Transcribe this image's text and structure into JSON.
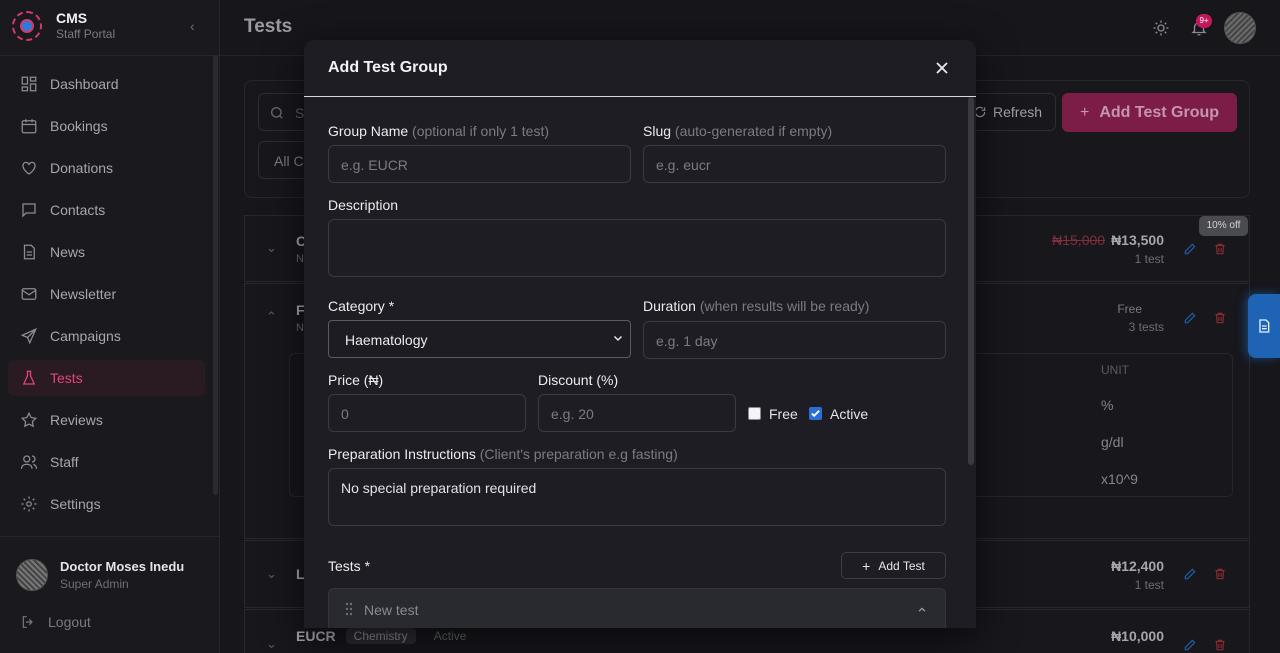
{
  "brand": {
    "title": "CMS",
    "subtitle": "Staff Portal"
  },
  "sidebar": {
    "items": [
      {
        "label": "Dashboard",
        "icon": "dashboard-icon"
      },
      {
        "label": "Bookings",
        "icon": "calendar-icon"
      },
      {
        "label": "Donations",
        "icon": "heart-icon"
      },
      {
        "label": "Contacts",
        "icon": "chat-icon"
      },
      {
        "label": "News",
        "icon": "document-icon"
      },
      {
        "label": "Newsletter",
        "icon": "mail-icon"
      },
      {
        "label": "Campaigns",
        "icon": "send-icon"
      },
      {
        "label": "Tests",
        "icon": "flask-icon",
        "active": true
      },
      {
        "label": "Reviews",
        "icon": "star-icon"
      },
      {
        "label": "Staff",
        "icon": "users-icon"
      },
      {
        "label": "Settings",
        "icon": "gear-icon"
      }
    ],
    "user": {
      "name": "Doctor Moses Inedu",
      "role": "Super Admin"
    },
    "logout_label": "Logout"
  },
  "header": {
    "title": "Tests",
    "notification_badge": "9+"
  },
  "toolbar": {
    "search_placeholder": "S",
    "category_filter": "All C",
    "refresh_label": "Refresh",
    "add_group_label": "Add Test Group"
  },
  "cards": [
    {
      "name_fragment": "C",
      "sub_fragment": "N",
      "old_price": "₦15,000",
      "price": "₦13,500",
      "count": "1 test",
      "discount_badge": "10% off"
    },
    {
      "name_fragment": "F",
      "sub_fragment": "N",
      "price": "Free",
      "count": "3 tests"
    },
    {
      "name_fragment": "L",
      "price": "₦12,400",
      "count": "1 test"
    },
    {
      "name": "EUCR",
      "category": "Chemistry",
      "status": "Active",
      "price": "₦10,000"
    }
  ],
  "inner_table": {
    "unit_header": "UNIT",
    "units": [
      "%",
      "g/dl",
      "x10^9"
    ]
  },
  "modal": {
    "title": "Add Test Group",
    "group_name": {
      "label": "Group Name",
      "hint": "(optional if only 1 test)",
      "placeholder": "e.g. EUCR"
    },
    "slug": {
      "label": "Slug",
      "hint": "(auto-generated if empty)",
      "placeholder": "e.g. eucr"
    },
    "description": {
      "label": "Description",
      "value": ""
    },
    "category": {
      "label": "Category *",
      "selected": "Haematology"
    },
    "duration": {
      "label": "Duration",
      "hint": "(when results will be ready)",
      "placeholder": "e.g. 1 day"
    },
    "price": {
      "label": "Price (₦)",
      "value": "0"
    },
    "discount": {
      "label": "Discount (%)",
      "placeholder": "e.g. 20"
    },
    "free": {
      "label": "Free",
      "checked": false
    },
    "active": {
      "label": "Active",
      "checked": true
    },
    "preparation": {
      "label": "Preparation Instructions",
      "hint": "(Client's preparation e.g fasting)",
      "value": "No special preparation required"
    },
    "tests": {
      "label": "Tests *",
      "add_label": "Add Test",
      "items": [
        {
          "name": "New test"
        }
      ]
    }
  },
  "colors": {
    "accent": "#e0457b",
    "primary_button": "#7c1d48",
    "checkbox": "#2a6fd6",
    "float_button": "#1f64b4"
  }
}
